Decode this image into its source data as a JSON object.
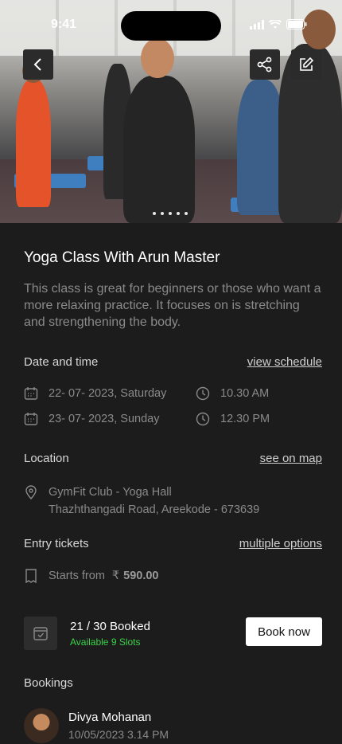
{
  "status_bar": {
    "time": "9:41"
  },
  "hero": {
    "carousel_dots": 5
  },
  "class": {
    "title": "Yoga Class With Arun Master",
    "description": "This class is great for beginners or those who want a more relaxing practice. It focuses on is stretching and strengthening the body."
  },
  "date_time": {
    "label": "Date and time",
    "link": "view schedule",
    "entries": [
      {
        "date": "22- 07- 2023, Saturday",
        "time": "10.30 AM"
      },
      {
        "date": "23- 07- 2023, Sunday",
        "time": "12.30 PM"
      }
    ]
  },
  "location": {
    "label": "Location",
    "link": "see on map",
    "name": "GymFit Club - Yoga Hall",
    "address": "Thazhthangadi Road, Areekode -  673639"
  },
  "tickets": {
    "label": "Entry tickets",
    "link": "multiple options",
    "prefix": "Starts from",
    "currency": "₹",
    "price": "590.00"
  },
  "booking_status": {
    "booked": "21 / 30 Booked",
    "available": "Available 9 Slots",
    "button": "Book now"
  },
  "bookings": {
    "label": "Bookings",
    "items": [
      {
        "name": "Divya Mohanan",
        "datetime": "10/05/2023  3.14 PM"
      }
    ]
  },
  "colors": {
    "background": "#1c1c1c",
    "available": "#3bd24a",
    "button_bg": "#ffffff"
  }
}
